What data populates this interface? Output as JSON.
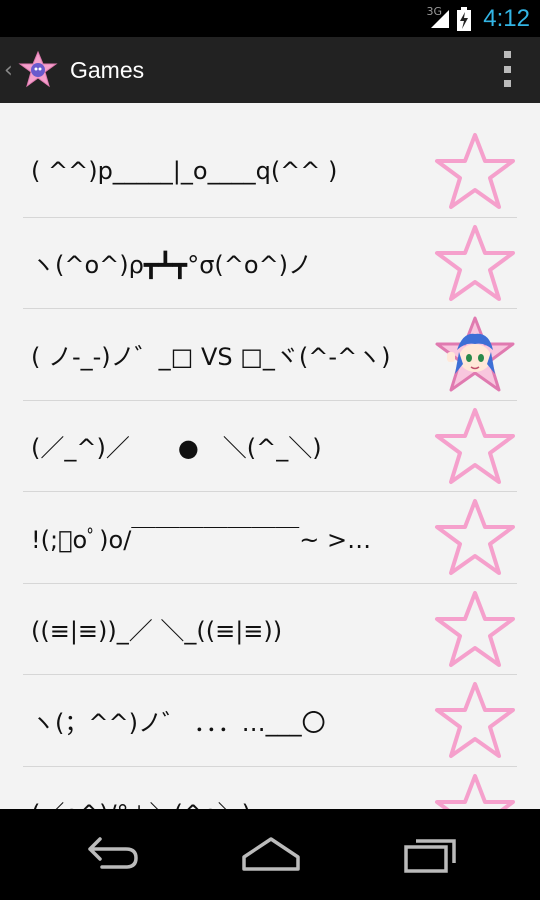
{
  "status_bar": {
    "network": "3G",
    "time": "4:12"
  },
  "action_bar": {
    "title": "Games"
  },
  "colors": {
    "clock": "#33b5e5",
    "star_outline": "#f5a0cc",
    "action_bar": "#222222",
    "content_bg": "#f3f3f3"
  },
  "items": [
    {
      "text": "( ^^)p_____|_o____q(^^ )",
      "favorite": false
    },
    {
      "text": "ヽ(^o^)ρ┳┻┳°σ(^o^)ノ",
      "favorite": false
    },
    {
      "text": "( ノ-_-)ノ゛_□ VS □_ヾ(^-^ヽ)",
      "favorite": true
    },
    {
      "text": "(／_^)／　　●　＼(^_＼)",
      "favorite": false
    },
    {
      "text": "!(;ﾟoﾟ)o/￣￣￣￣￣￣￣~ >…",
      "favorite": false
    },
    {
      "text": "((≡|≡))_／ ＼_((≡|≡))",
      "favorite": false
    },
    {
      "text": "ヽ(；^^)ノ゛ ．．．…___〇",
      "favorite": false
    },
    {
      "text": "(／o^)/°⊥＼(^o＼)",
      "favorite": false
    }
  ],
  "icons": {
    "back": "back-icon",
    "home": "home-icon",
    "recent": "recent-apps-icon",
    "overflow": "overflow-menu-icon",
    "star": "star-outline-icon",
    "favorite": "anime-star-icon"
  }
}
